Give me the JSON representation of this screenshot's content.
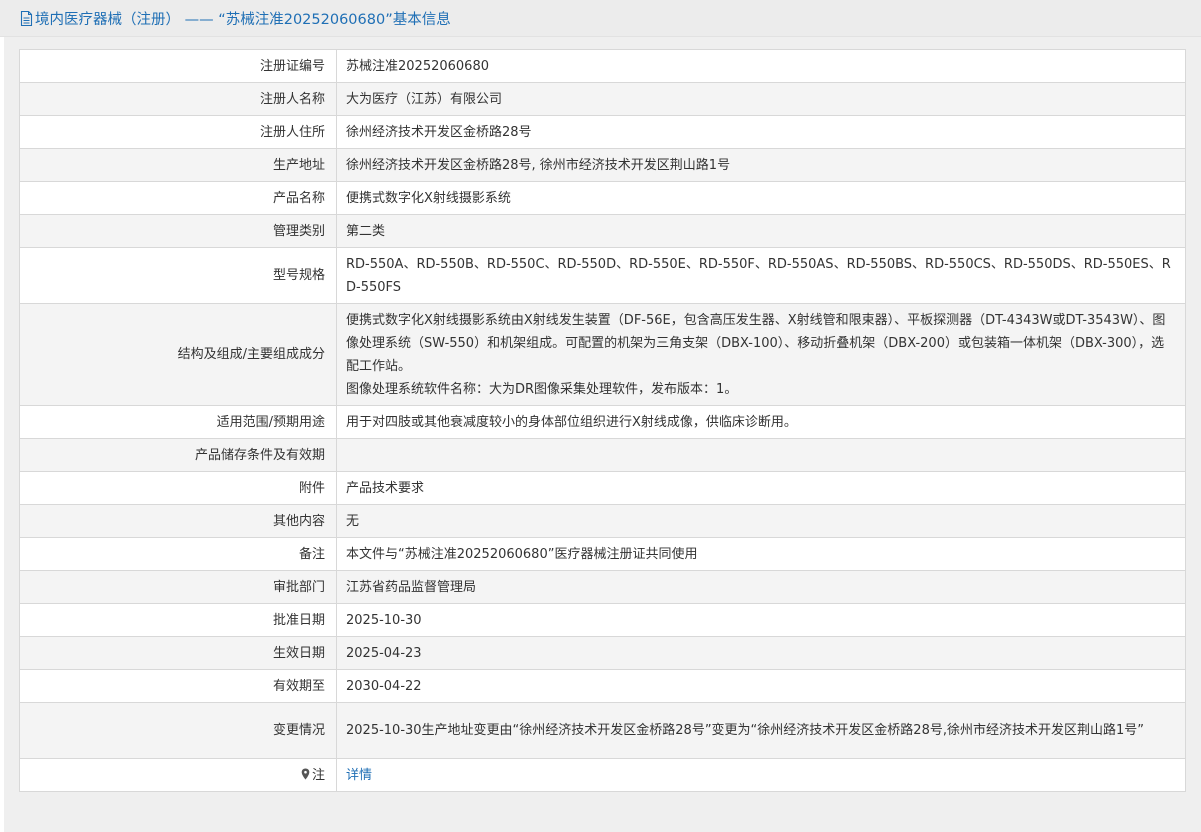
{
  "header": {
    "title": "境内医疗器械（注册） —— “苏械注准20252060680”基本信息"
  },
  "rows": [
    {
      "label": "注册证编号",
      "value": "苏械注准20252060680"
    },
    {
      "label": "注册人名称",
      "value": "大为医疗（江苏）有限公司"
    },
    {
      "label": "注册人住所",
      "value": "徐州经济技术开发区金桥路28号"
    },
    {
      "label": "生产地址",
      "value": "徐州经济技术开发区金桥路28号, 徐州市经济技术开发区荆山路1号"
    },
    {
      "label": "产品名称",
      "value": "便携式数字化X射线摄影系统"
    },
    {
      "label": "管理类别",
      "value": "第二类"
    },
    {
      "label": "型号规格",
      "value": "RD-550A、RD-550B、RD-550C、RD-550D、RD-550E、RD-550F、RD-550AS、RD-550BS、RD-550CS、RD-550DS、RD-550ES、RD-550FS"
    },
    {
      "label": "结构及组成/主要组成成分",
      "value": "便携式数字化X射线摄影系统由X射线发生装置（DF-56E，包含高压发生器、X射线管和限束器）、平板探测器（DT-4343W或DT-3543W）、图像处理系统（SW-550）和机架组成。可配置的机架为三角支架（DBX-100）、移动折叠机架（DBX-200）或包装箱一体机架（DBX-300），选配工作站。",
      "value2": "图像处理系统软件名称：大为DR图像采集处理软件，发布版本：1。"
    },
    {
      "label": "适用范围/预期用途",
      "value": "用于对四肢或其他衰减度较小的身体部位组织进行X射线成像，供临床诊断用。"
    },
    {
      "label": "产品储存条件及有效期",
      "value": ""
    },
    {
      "label": "附件",
      "value": "产品技术要求"
    },
    {
      "label": "其他内容",
      "value": "无"
    },
    {
      "label": "备注",
      "value": "本文件与“苏械注准20252060680”医疗器械注册证共同使用"
    },
    {
      "label": "审批部门",
      "value": "江苏省药品监督管理局"
    },
    {
      "label": "批准日期",
      "value": "2025-10-30"
    },
    {
      "label": "生效日期",
      "value": "2025-04-23"
    },
    {
      "label": "有效期至",
      "value": "2030-04-22"
    },
    {
      "label": "变更情况",
      "value": "2025-10-30生产地址变更由“徐州经济技术开发区金桥路28号”变更为“徐州经济技术开发区金桥路28号,徐州市经济技术开发区荆山路1号”"
    },
    {
      "label": "注",
      "value": "详情",
      "icon": "location-pin-icon"
    }
  ],
  "colors": {
    "link": "#1f6fb5",
    "header_bg": "#ececec",
    "row_alt_bg": "#f4f4f4",
    "border": "#d8d8d8"
  }
}
